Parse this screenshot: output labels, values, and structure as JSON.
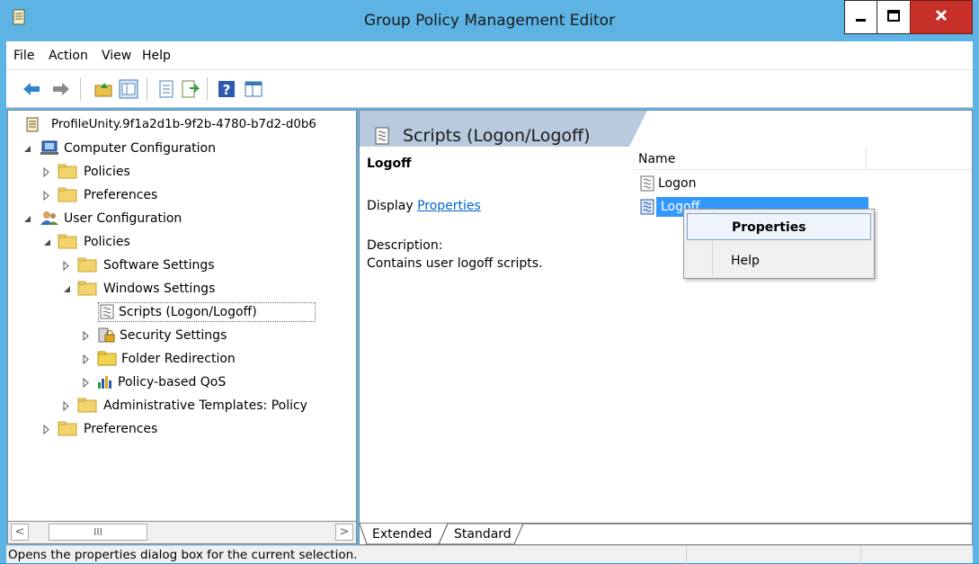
{
  "window": {
    "title": "Group Policy Management Editor"
  },
  "menu": {
    "items": [
      "File",
      "Action",
      "View",
      "Help"
    ]
  },
  "tree": {
    "root": "ProfileUnity.9f1a2d1b-9f2b-4780-b7d2-d0b6",
    "computer_config": "Computer Configuration",
    "cc_policies": "Policies",
    "cc_preferences": "Preferences",
    "user_config": "User Configuration",
    "uc_policies": "Policies",
    "software_settings": "Software Settings",
    "windows_settings": "Windows Settings",
    "scripts": "Scripts (Logon/Logoff)",
    "security_settings": "Security Settings",
    "folder_redirection": "Folder Redirection",
    "policy_qos": "Policy-based QoS",
    "admin_templates": "Administrative Templates: Policy",
    "uc_preferences": "Preferences"
  },
  "scroll": {
    "left": "<",
    "thumb": "III",
    "right": ">"
  },
  "details": {
    "header": "Scripts (Logon/Logoff)",
    "item_title": "Logoff",
    "display_label": "Display ",
    "display_link": "Properties ",
    "description_label": "Description:",
    "description_text": "Contains user logoff scripts."
  },
  "list": {
    "column_name": "Name",
    "items": [
      "Logon",
      "Logoff"
    ]
  },
  "context_menu": {
    "items": [
      "Properties",
      "Help"
    ]
  },
  "tabs": {
    "extended": "Extended",
    "standard": "Standard"
  },
  "status": {
    "text": "Opens the properties dialog box for the current selection."
  },
  "colors": {
    "titlebar": "#5cb3e4",
    "selection": "#3399ff",
    "close_button": "#c7312a",
    "link": "#0066cc"
  }
}
